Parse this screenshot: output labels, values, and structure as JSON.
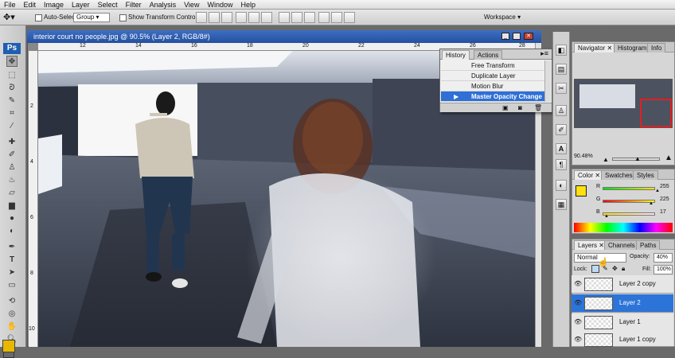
{
  "menu": [
    "File",
    "Edit",
    "Image",
    "Layer",
    "Select",
    "Filter",
    "Analysis",
    "View",
    "Window",
    "Help"
  ],
  "options": {
    "auto_select_label": "Auto-Select:",
    "auto_select_value": "Group",
    "show_transform_label": "Show Transform Controls",
    "workspace_label": "Workspace"
  },
  "tools": {
    "ps_logo": "Ps"
  },
  "document": {
    "title": "interior court no people.jpg @ 90.5% (Layer 2, RGB/8#)",
    "ruler_ticks": [
      "12",
      "14",
      "16",
      "18",
      "20",
      "22",
      "24",
      "26",
      "28"
    ],
    "vruler_ticks": [
      "2",
      "4",
      "6",
      "8",
      "10"
    ]
  },
  "history": {
    "tabs": [
      "History",
      "Actions"
    ],
    "items": [
      "Free Transform",
      "Duplicate Layer",
      "Motion Blur",
      "Master Opacity Change"
    ]
  },
  "navigator": {
    "tabs": [
      "Navigator",
      "Histogram",
      "Info"
    ],
    "zoom": "90.48%"
  },
  "color": {
    "tabs": [
      "Color",
      "Swatches",
      "Styles"
    ],
    "r_label": "R",
    "g_label": "G",
    "b_label": "B",
    "r": "255",
    "g": "225",
    "b": "17",
    "foreground": "#ffe111"
  },
  "layers": {
    "tabs": [
      "Layers",
      "Channels",
      "Paths"
    ],
    "blend_mode": "Normal",
    "opacity_label": "Opacity:",
    "opacity": "40%",
    "lock_label": "Lock:",
    "fill_label": "Fill:",
    "fill": "100%",
    "rows": [
      "Layer 2 copy",
      "Layer 2",
      "Layer 1",
      "Layer 1 copy"
    ]
  },
  "colors": {
    "selection_blue": "#2d74d8",
    "title_blue": "#2450a0"
  }
}
